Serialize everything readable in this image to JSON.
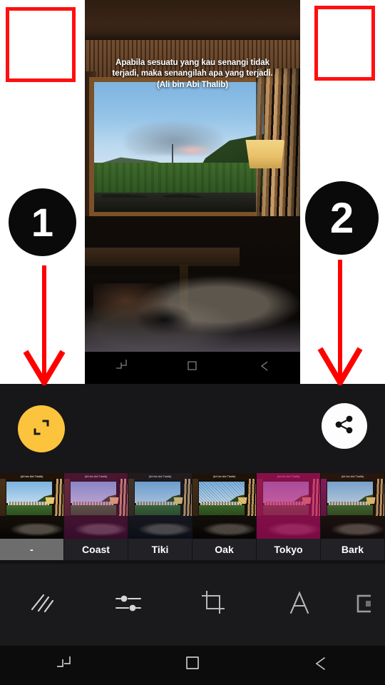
{
  "annotations": {
    "step1": {
      "label": "1",
      "icon": "numbered-badge",
      "points_to": "expand-fullscreen-button"
    },
    "step2": {
      "label": "2",
      "icon": "numbered-badge",
      "points_to": "share-button"
    },
    "highlight_color": "#ff0f0f",
    "arrow_color": "#ff0000"
  },
  "inner_screenshot": {
    "quote": "Apabila sesuatu yang kau senangi tidak terjadi, maka senangilah apa yang terjadi. (Ali bin Abi Thalib)",
    "quote_lines": [
      "Apabila sesuatu yang kau senangi tidak",
      "terjadi, maka senangilah apa yang terjadi.",
      "(Ali bin Abi Thalib)"
    ],
    "nav": {
      "recents_icon": "recents-icon",
      "home_icon": "home-square-icon",
      "back_icon": "back-arrow-icon"
    }
  },
  "editor": {
    "expand_button": {
      "icon": "expand-fullscreen-icon",
      "color": "#fcc43c"
    },
    "share_button": {
      "icon": "share-icon",
      "color": "#fdfdfd"
    },
    "filters": [
      {
        "label": "-",
        "selected": true
      },
      {
        "label": "Coast",
        "selected": false
      },
      {
        "label": "Tiki",
        "selected": false
      },
      {
        "label": "Oak",
        "selected": false
      },
      {
        "label": "Tokyo",
        "selected": false
      },
      {
        "label": "Bark",
        "selected": false
      }
    ],
    "filter_thumb_caption": "(Ali bin Abi Thalib)",
    "tools": [
      {
        "name": "filter-tool",
        "icon": "diagonal-lines-icon",
        "label": "Filter"
      },
      {
        "name": "adjust-tool",
        "icon": "sliders-icon",
        "label": "Adjust"
      },
      {
        "name": "crop-tool",
        "icon": "crop-icon",
        "label": "Crop"
      },
      {
        "name": "text-tool",
        "icon": "text-a-icon",
        "label": "Text"
      },
      {
        "name": "frame-tool",
        "icon": "frame-square-icon",
        "label": "Frame"
      }
    ],
    "nav": {
      "recents_icon": "recents-icon",
      "home_icon": "home-square-icon",
      "back_icon": "back-arrow-icon"
    }
  }
}
